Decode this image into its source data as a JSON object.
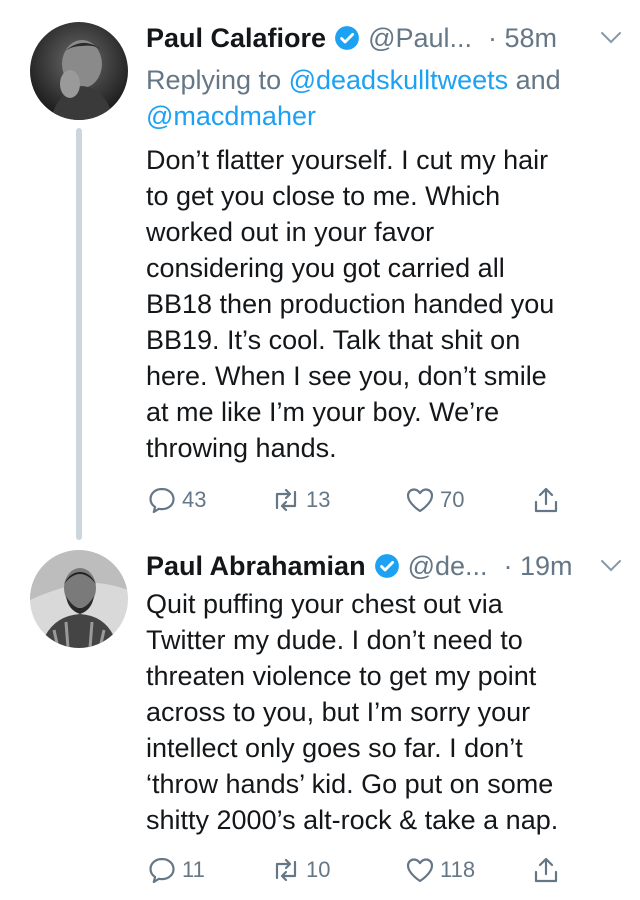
{
  "tweets": [
    {
      "author_name": "Paul Calafiore",
      "handle": "@Paul...",
      "time": "· 58m",
      "reply_prefix": "Replying to ",
      "reply_mention_1": "@deadskulltweets",
      "reply_joiner": " and",
      "reply_mention_2": "@macdmaher",
      "text": "Don’t flatter yourself. I cut my hair\nto get you close to me. Which\nworked out in your favor\nconsidering you got carried all\nBB18 then production handed you\nBB19. It’s cool. Talk that shit on\nhere. When I see you, don’t smile\nat me like I’m your boy. We’re\nthrowing hands.",
      "replies": "43",
      "retweets": "13",
      "likes": "70"
    },
    {
      "author_name": "Paul Abrahamian",
      "handle": "@de...",
      "time": "· 19m",
      "text": "Quit puffing your chest out via\nTwitter my dude. I don’t need to\nthreaten violence to get my point\nacross to you, but I’m sorry your\nintellect only goes so far. I don’t\n‘throw hands’ kid. Go put on some\nshitty 2000’s alt-rock & take a nap.",
      "replies": "11",
      "retweets": "10",
      "likes": "118"
    }
  ],
  "colors": {
    "link": "#1da1f2",
    "secondary_text": "#657786",
    "thread_line": "#ccd6dd",
    "verified_badge": "#1da1f2"
  },
  "icons": [
    "verified-badge-icon",
    "chevron-down-icon",
    "reply-icon",
    "retweet-icon",
    "like-icon",
    "share-icon"
  ]
}
